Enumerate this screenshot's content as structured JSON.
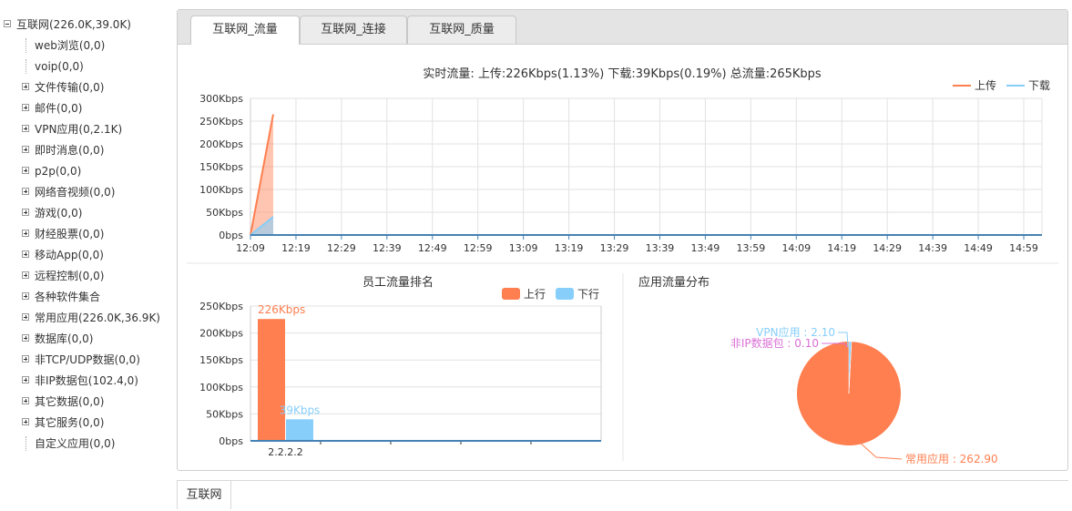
{
  "tree": {
    "root": "互联网(226.0K,39.0K)",
    "items": [
      {
        "label": "web浏览(0,0)",
        "expandable": false
      },
      {
        "label": "voip(0,0)",
        "expandable": false
      },
      {
        "label": "文件传输(0,0)",
        "expandable": true
      },
      {
        "label": "邮件(0,0)",
        "expandable": true
      },
      {
        "label": "VPN应用(0,2.1K)",
        "expandable": true
      },
      {
        "label": "即时消息(0,0)",
        "expandable": true
      },
      {
        "label": "p2p(0,0)",
        "expandable": true
      },
      {
        "label": "网络音视频(0,0)",
        "expandable": true
      },
      {
        "label": "游戏(0,0)",
        "expandable": true
      },
      {
        "label": "财经股票(0,0)",
        "expandable": true
      },
      {
        "label": "移动App(0,0)",
        "expandable": true
      },
      {
        "label": "远程控制(0,0)",
        "expandable": true
      },
      {
        "label": "各种软件集合",
        "expandable": true
      },
      {
        "label": "常用应用(226.0K,36.9K)",
        "expandable": true
      },
      {
        "label": "数据库(0,0)",
        "expandable": true
      },
      {
        "label": "非TCP/UDP数据(0,0)",
        "expandable": true
      },
      {
        "label": "非IP数据包(102.4,0)",
        "expandable": true
      },
      {
        "label": "其它数据(0,0)",
        "expandable": true
      },
      {
        "label": "其它服务(0,0)",
        "expandable": true
      },
      {
        "label": "自定义应用(0,0)",
        "expandable": false
      }
    ]
  },
  "tabs": [
    {
      "label": "互联网_流量",
      "active": true
    },
    {
      "label": "互联网_连接",
      "active": false
    },
    {
      "label": "互联网_质量",
      "active": false
    }
  ],
  "bottom_tab": "互联网",
  "colors": {
    "upload": "#ff7f50",
    "download": "#87cefa",
    "axis": "#4682b4"
  },
  "chart_data": [
    {
      "type": "area",
      "title": "实时流量:  上传:226Kbps(1.13%)  下载:39Kbps(0.19%)  总流量:265Kbps",
      "categories": [
        "12:09",
        "12:19",
        "12:29",
        "12:39",
        "12:49",
        "12:59",
        "13:09",
        "13:19",
        "13:29",
        "13:39",
        "13:49",
        "13:59",
        "14:09",
        "14:19",
        "14:29",
        "14:39",
        "14:49",
        "14:59"
      ],
      "y_ticks": [
        "300Kbps",
        "250Kbps",
        "200Kbps",
        "150Kbps",
        "100Kbps",
        "50Kbps",
        "0bps"
      ],
      "ylim": [
        0,
        300
      ],
      "series": [
        {
          "name": "上传",
          "x": [
            "12:09",
            "12:14"
          ],
          "values": [
            0,
            265
          ]
        },
        {
          "name": "下载",
          "x": [
            "12:09",
            "12:14"
          ],
          "values": [
            0,
            40
          ]
        }
      ],
      "legend": "top-right",
      "grid": true
    },
    {
      "type": "bar",
      "title": "员工流量排名",
      "categories": [
        "2.2.2.2"
      ],
      "y_ticks": [
        "250Kbps",
        "200Kbps",
        "150Kbps",
        "100Kbps",
        "50Kbps",
        "0bps"
      ],
      "ylim": [
        0,
        250
      ],
      "series": [
        {
          "name": "上行",
          "values": [
            226
          ],
          "label": "226Kbps"
        },
        {
          "name": "下行",
          "values": [
            40
          ],
          "label": "39Kbps"
        }
      ],
      "legend": "top-right",
      "grid": true
    },
    {
      "type": "pie",
      "title": "应用流量分布",
      "slices": [
        {
          "name": "常用应用",
          "value": 262.9,
          "label": "常用应用 : 262.90",
          "color": "#ff7f50"
        },
        {
          "name": "VPN应用",
          "value": 2.1,
          "label": "VPN应用 : 2.10",
          "color": "#87cefa"
        },
        {
          "name": "非IP数据包",
          "value": 0.1,
          "label": "非IP数据包 : 0.10",
          "color": "#da70d6"
        }
      ]
    }
  ]
}
